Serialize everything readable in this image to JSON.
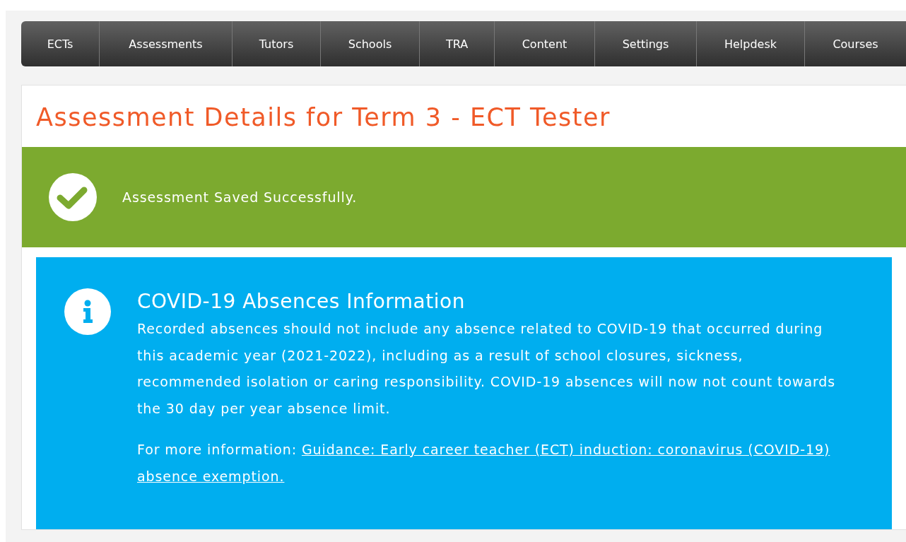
{
  "nav": {
    "items": [
      {
        "label": "ECTs"
      },
      {
        "label": "Assessments"
      },
      {
        "label": "Tutors"
      },
      {
        "label": "Schools"
      },
      {
        "label": "TRA"
      },
      {
        "label": "Content"
      },
      {
        "label": "Settings"
      },
      {
        "label": "Helpdesk"
      },
      {
        "label": "Courses"
      }
    ]
  },
  "page_title": "Assessment Details for Term 3 - ECT Tester",
  "success_alert": {
    "message": "Assessment Saved Successfully."
  },
  "info_alert": {
    "title": "COVID-19 Absences Information",
    "body": "Recorded absences should not include any absence related to COVID-19 that occurred during this academic year (2021-2022), including as a result of school closures, sickness, recommended isolation or caring responsibility. COVID-19 absences will now not count towards the 30 day per year absence limit.",
    "more_label": "For more information:",
    "link": "Guidance: Early career teacher (ECT) induction: coronavirus (COVID-19) absence exemption."
  }
}
